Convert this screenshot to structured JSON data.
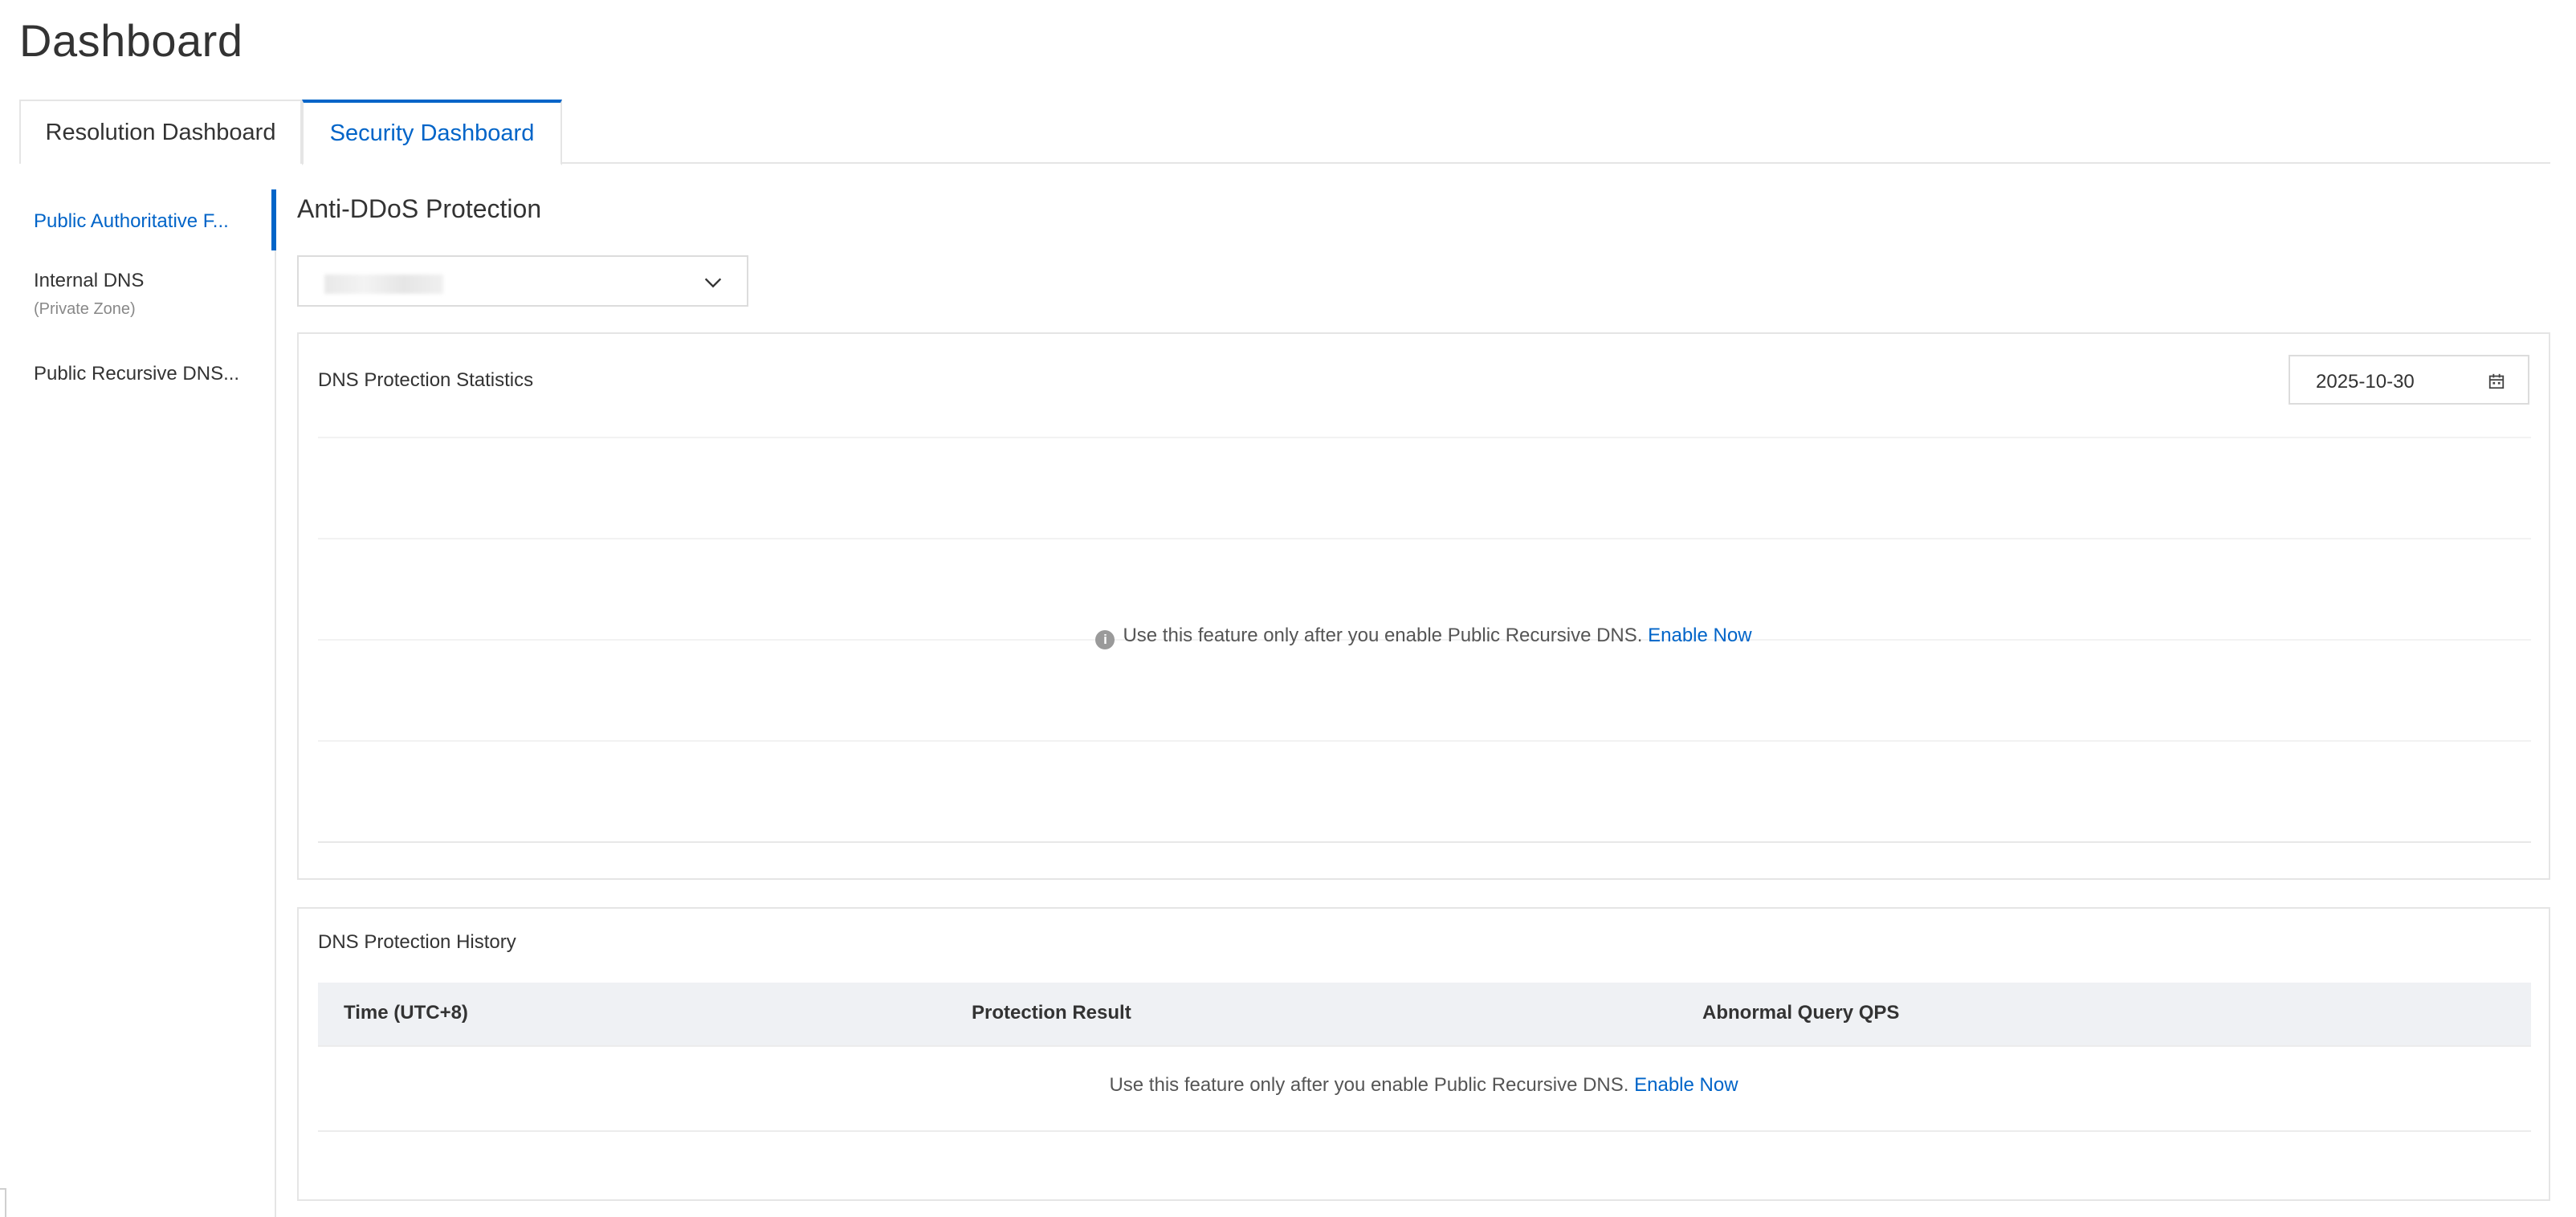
{
  "page": {
    "title": "Dashboard"
  },
  "tabs": [
    {
      "label": "Resolution Dashboard",
      "active": false
    },
    {
      "label": "Security Dashboard",
      "active": true
    }
  ],
  "sidebar": {
    "items": [
      {
        "label": "Public Authoritative F...",
        "active": true
      },
      {
        "label": "Internal DNS",
        "sub": "(Private Zone)",
        "active": false
      },
      {
        "label": "Public Recursive DNS...",
        "active": false
      }
    ]
  },
  "main": {
    "section_title": "Anti-DDoS Protection",
    "statistics": {
      "title": "DNS Protection Statistics",
      "date": "2025-10-30",
      "notice": "Use this feature only after you enable Public Recursive DNS.",
      "link": "Enable Now"
    },
    "history": {
      "title": "DNS Protection History",
      "columns": [
        "Time (UTC+8)",
        "Protection Result",
        "Abnormal Query QPS"
      ],
      "notice": "Use this feature only after you enable Public Recursive DNS.",
      "link": "Enable Now"
    }
  },
  "colors": {
    "accent": "#0064c8",
    "border": "#e5e5e5",
    "table_header": "#eff1f4"
  },
  "icons": {
    "select": "chevron-down-icon",
    "date": "calendar-icon",
    "notice": "info-icon"
  }
}
